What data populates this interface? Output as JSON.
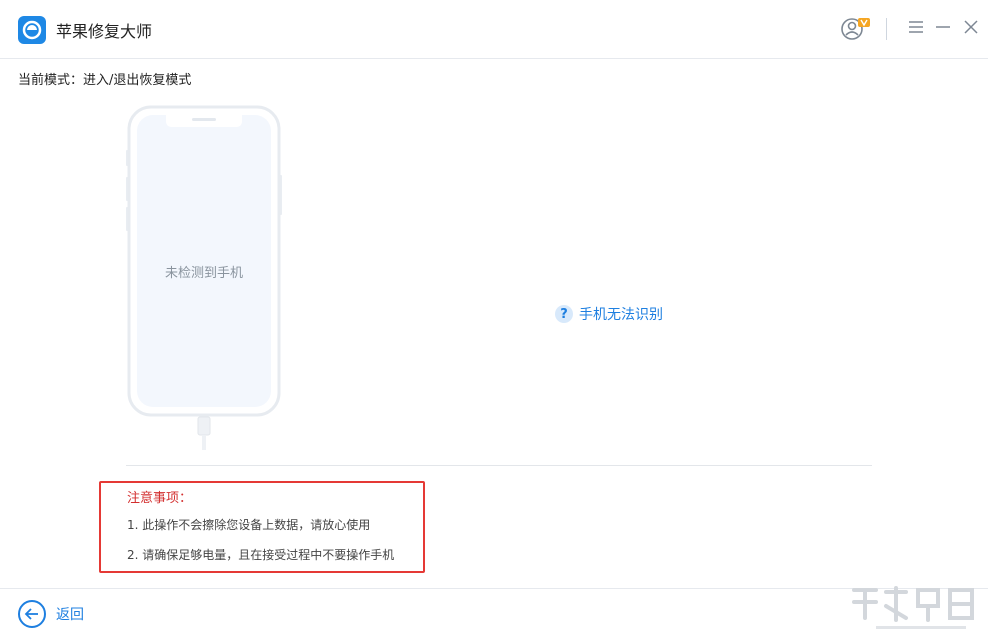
{
  "app": {
    "title": "苹果修复大师"
  },
  "mode": {
    "label": "当前模式：进入/退出恢复模式"
  },
  "device": {
    "status": "未检测到手机"
  },
  "help": {
    "label": "手机无法识别"
  },
  "notes": {
    "title": "注意事项：",
    "items": [
      "1. 此操作不会擦除您设备上数据，请放心使用",
      "2. 请确保足够电量，且在接受过程中不要操作手机"
    ]
  },
  "footer": {
    "back_label": "返回"
  },
  "colors": {
    "accent": "#1e7fe0",
    "warning": "#e53935",
    "phone_screen": "#f3f7fd"
  }
}
